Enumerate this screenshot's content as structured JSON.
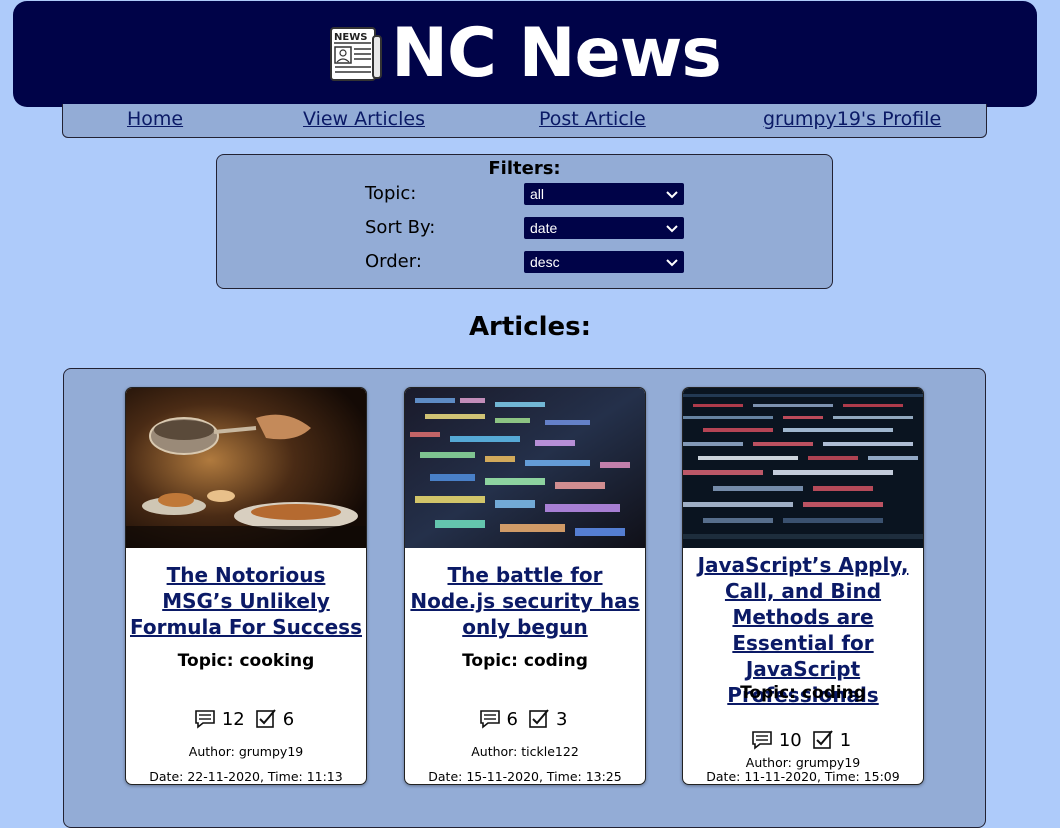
{
  "header": {
    "title": "NC News",
    "logo_icon": "newspaper-icon",
    "logo_text": "NEWS",
    "background": "#000348"
  },
  "nav": {
    "links": [
      {
        "label": "Home"
      },
      {
        "label": "View Articles"
      },
      {
        "label": "Post Article"
      },
      {
        "label": "grumpy19's Profile"
      }
    ]
  },
  "filters": {
    "title": "Filters:",
    "topic_label": "Topic:",
    "topic_value": "all",
    "sort_label": "Sort By:",
    "sort_value": "date",
    "order_label": "Order:",
    "order_value": "desc"
  },
  "articles_heading": "Articles:",
  "articles": [
    {
      "title": "The Notorious MSG’s Unlikely Formula For Success",
      "topic": "Topic: cooking",
      "comments": "12",
      "votes": "6",
      "author": "Author: grumpy19",
      "date": "Date: 22-11-2020, Time: 11:13"
    },
    {
      "title": "The battle for Node.js security has only begun",
      "topic": "Topic: coding",
      "comments": "6",
      "votes": "3",
      "author": "Author: tickle122",
      "date": "Date: 15-11-2020, Time: 13:25"
    },
    {
      "title": "JavaScript’s Apply, Call, and Bind Methods are Essential for JavaScript Professionals",
      "topic": "Topic: coding",
      "comments": "10",
      "votes": "1",
      "author": "Author: grumpy19",
      "date": "Date: 11-11-2020, Time: 15:09"
    }
  ],
  "icons": {
    "comments": "comment-icon",
    "votes": "checkbox-icon"
  },
  "colors": {
    "page_bg": "#aecbfa",
    "panel_bg": "#93acd6",
    "link": "#0b1a66"
  }
}
